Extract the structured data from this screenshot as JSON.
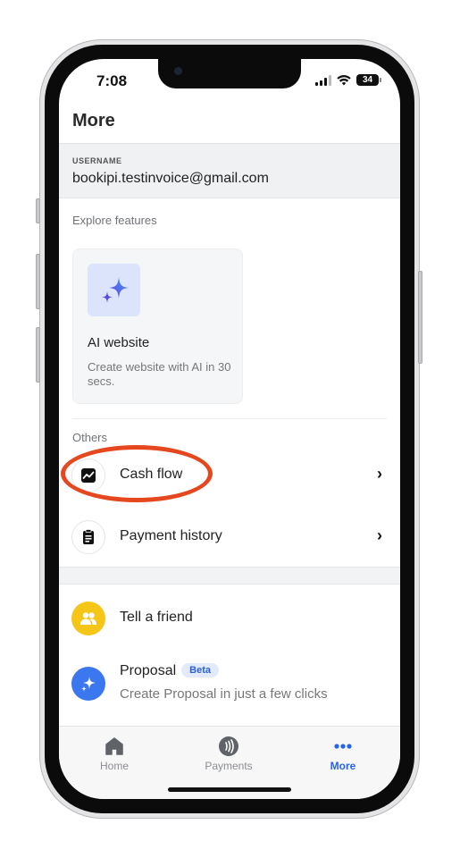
{
  "status_bar": {
    "time": "7:08",
    "battery": "34"
  },
  "header": {
    "title": "More"
  },
  "account": {
    "label": "USERNAME",
    "value": "bookipi.testinvoice@gmail.com"
  },
  "explore": {
    "label": "Explore features",
    "card": {
      "title": "AI website",
      "description": "Create website with AI in 30 secs.",
      "icon": "sparkle-icon"
    }
  },
  "others": {
    "label": "Others",
    "items": [
      {
        "label": "Cash flow",
        "icon": "chart-icon"
      },
      {
        "label": "Payment history",
        "icon": "clipboard-icon"
      }
    ]
  },
  "extras": {
    "tell_friend": {
      "label": "Tell a friend",
      "icon": "people-icon",
      "color": "#f5c518"
    },
    "proposal": {
      "label": "Proposal",
      "badge": "Beta",
      "subtitle": "Create Proposal in just a few clicks",
      "icon": "sparkle-icon",
      "color": "#3b78f0"
    }
  },
  "tabbar": {
    "tabs": [
      {
        "label": "Home",
        "icon": "home-icon",
        "active": false
      },
      {
        "label": "Payments",
        "icon": "payments-icon",
        "active": false
      },
      {
        "label": "More",
        "icon": "more-icon",
        "active": true
      }
    ]
  },
  "colors": {
    "accent": "#2563eb",
    "highlight": "#e5481f"
  }
}
